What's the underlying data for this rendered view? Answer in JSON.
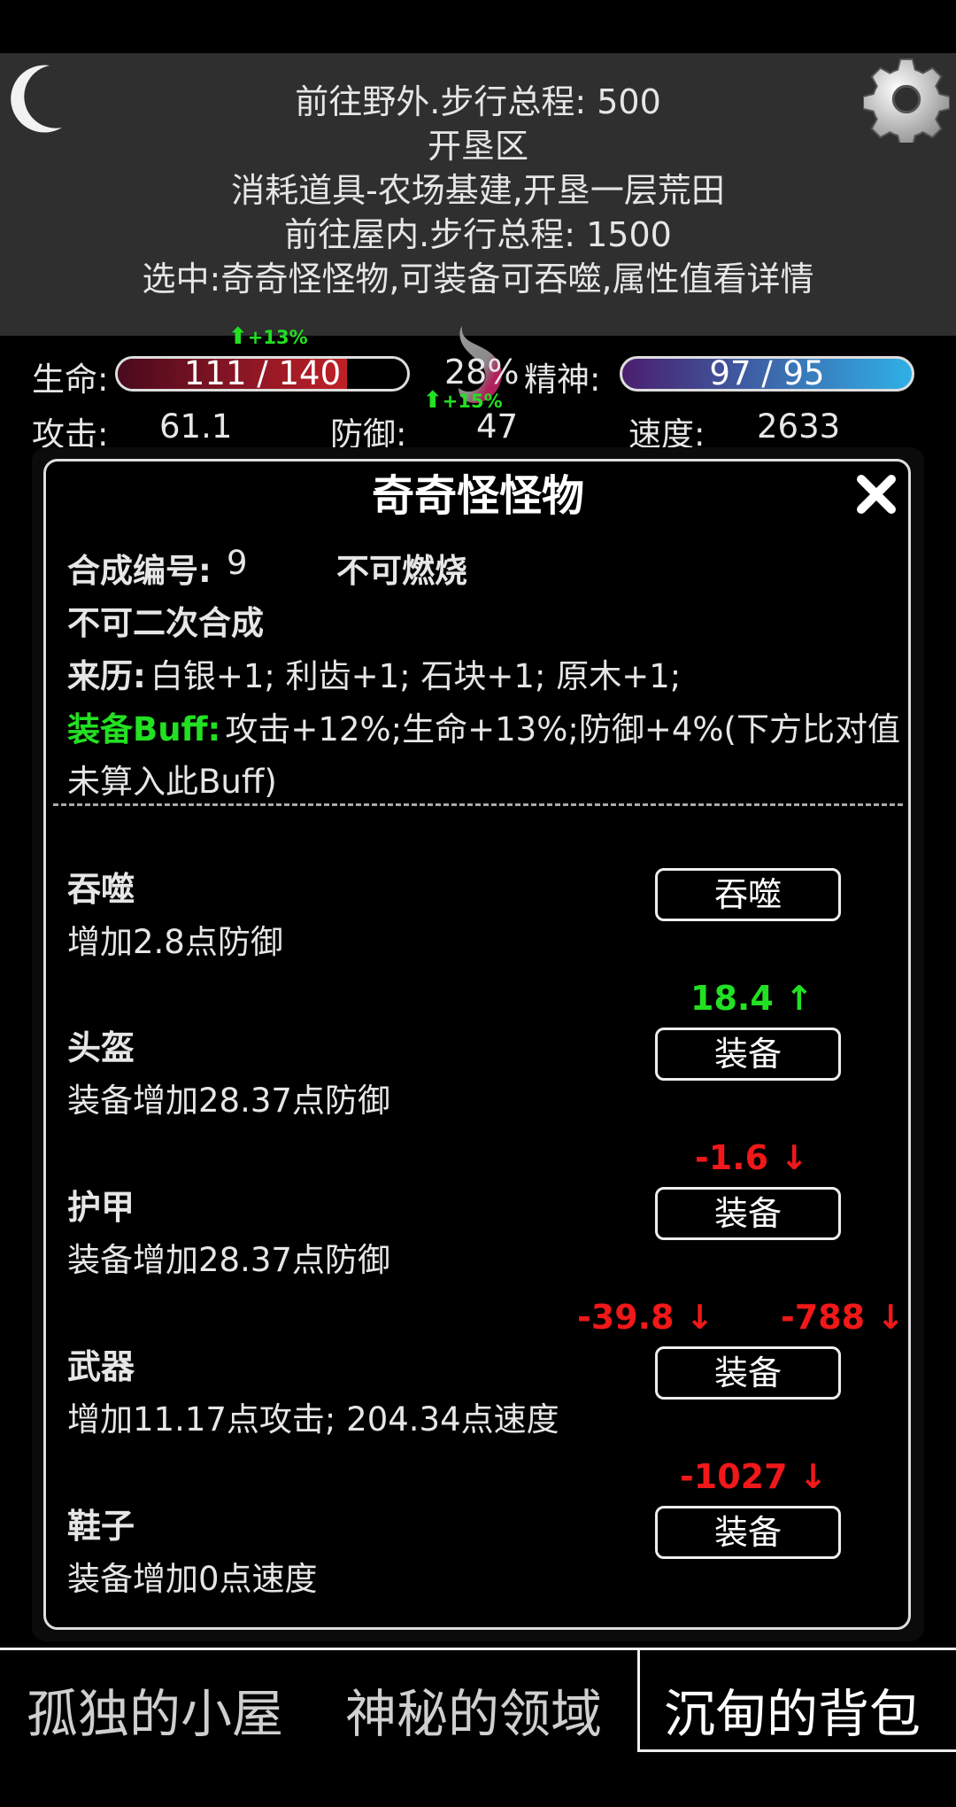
{
  "log": {
    "lines": [
      "前往野外.步行总程: 500",
      "开垦区",
      "消耗道具-农场基建,开垦一层荒田",
      "前往屋内.步行总程: 1500",
      "选中:奇奇怪怪物,可装备可吞噬,属性值看详情"
    ]
  },
  "stats": {
    "life_label": "生命:",
    "life_value": "111 / 140",
    "life_fraction": 0.793,
    "life_buff": "+13%",
    "percent": "28%",
    "spirit_label": "精神:",
    "spirit_value": "97 / 95",
    "attack_label": "攻击:",
    "attack_value": "61.1",
    "defense_label": "防御:",
    "defense_value": "47",
    "defense_buff": "+15%",
    "speed_label": "速度:",
    "speed_value": "2633"
  },
  "dialog": {
    "title": "奇奇怪怪物",
    "craft_id_label": "合成编号:",
    "craft_id_value": "9",
    "flammable": "不可燃烧",
    "recraft": "不可二次合成",
    "origin_label": "来历:",
    "origin_value": "白银+1; 利齿+1; 石块+1; 原木+1;",
    "buff_label": "装备Buff:",
    "buff_value_line1": "攻击+12%;生命+13%;防御+4%(下方比对值",
    "buff_value_line2": "未算入此Buff)",
    "slots": [
      {
        "title": "吞噬",
        "desc": "增加2.8点防御",
        "button": "吞噬"
      },
      {
        "title": "头盔",
        "desc": "装备增加28.37点防御",
        "button": "装备",
        "delta": "18.4 ↑"
      },
      {
        "title": "护甲",
        "desc": "装备增加28.37点防御",
        "button": "装备",
        "delta": "-1.6 ↓"
      },
      {
        "title": "武器",
        "desc": "增加11.17点攻击; 204.34点速度",
        "button": "装备",
        "delta": "-39.8 ↓",
        "delta2": "-788 ↓"
      },
      {
        "title": "鞋子",
        "desc": "装备增加0点速度",
        "button": "装备",
        "delta": "-1027 ↓"
      }
    ]
  },
  "tabs": [
    {
      "label": "孤独的小屋"
    },
    {
      "label": "神秘的领域"
    },
    {
      "label": "沉甸的背包",
      "active": true
    }
  ],
  "colors": {
    "life_bar": "#c02028",
    "spirit_bar_start": "#4a1e6e",
    "spirit_bar_end": "#2fb0e6",
    "buff_green": "#22e022",
    "decrease_red": "#f01818"
  },
  "icons": {
    "moon": "crescent-moon-icon",
    "settings": "gear-icon",
    "close": "close-icon",
    "flame": "flame-icon"
  }
}
